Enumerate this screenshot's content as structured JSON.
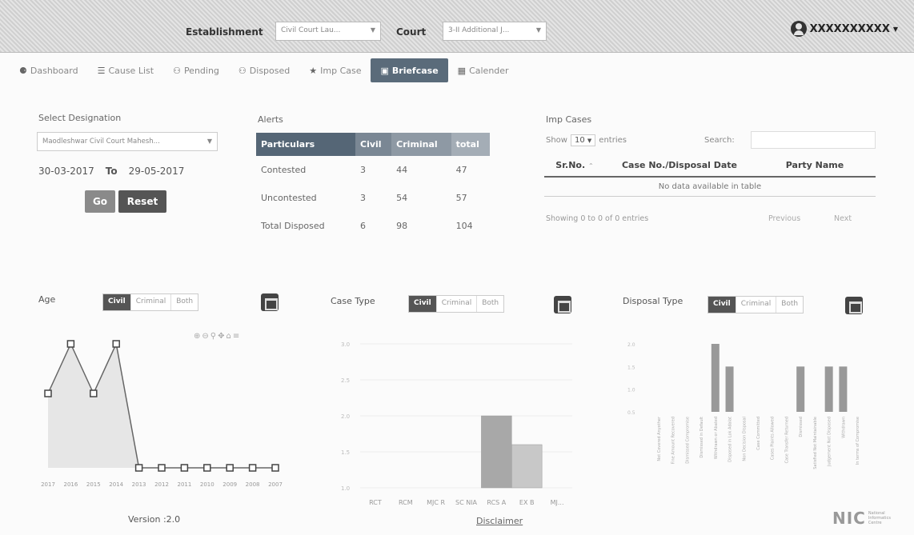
{
  "header": {
    "establishment_label": "Establishment",
    "establishment_value": "Civil Court Lau...",
    "court_label": "Court",
    "court_value": "3-II Additional J...",
    "user_name": "XXXXXXXXXX"
  },
  "tabs": [
    {
      "label": "Dashboard",
      "icon": "dashboard-icon"
    },
    {
      "label": "Cause List",
      "icon": "list-icon"
    },
    {
      "label": "Pending",
      "icon": "users-icon"
    },
    {
      "label": "Disposed",
      "icon": "users-icon"
    },
    {
      "label": "Imp Case",
      "icon": "star-icon"
    },
    {
      "label": "Briefcase",
      "icon": "briefcase-icon",
      "active": true
    },
    {
      "label": "Calender",
      "icon": "calendar-icon"
    }
  ],
  "designation": {
    "title": "Select Designation",
    "select_value": "Maodleshwar Civil Court Mahesh...",
    "from_date": "30-03-2017",
    "to_label": "To",
    "to_date": "29-05-2017",
    "go_label": "Go",
    "reset_label": "Reset"
  },
  "alerts": {
    "title": "Alerts",
    "headers": [
      "Particulars",
      "Civil",
      "Criminal",
      "total"
    ],
    "rows": [
      [
        "Contested",
        "3",
        "44",
        "47"
      ],
      [
        "Uncontested",
        "3",
        "54",
        "57"
      ],
      [
        "Total Disposed",
        "6",
        "98",
        "104"
      ]
    ]
  },
  "imp_cases": {
    "title": "Imp Cases",
    "show_label": "Show",
    "show_value": "10",
    "entries_label": "entries",
    "search_label": "Search:",
    "headers": [
      "Sr.No.",
      "Case No./Disposal Date",
      "Party Name"
    ],
    "empty_text": "No data available in table",
    "showing_text": "Showing 0 to 0 of 0 entries",
    "prev_label": "Previous",
    "next_label": "Next"
  },
  "toggle_labels": [
    "Civil",
    "Criminal",
    "Both"
  ],
  "colors": {
    "accent": "#5a6b7a",
    "go_button": "#8a8a8a",
    "reset_button": "#555555"
  },
  "chart_data": [
    {
      "type": "line",
      "title": "Age",
      "categories": [
        "2017",
        "2016",
        "2015",
        "2014",
        "2013",
        "2012",
        "2011",
        "2010",
        "2009",
        "2008",
        "2007"
      ],
      "values": [
        1.5,
        2.5,
        1.5,
        2.5,
        0,
        0,
        0,
        0,
        0,
        0,
        0
      ]
    },
    {
      "type": "bar",
      "title": "Case Type",
      "categories": [
        "RCT",
        "RCM",
        "MJC R",
        "SC NIA",
        "RCS A",
        "EX B",
        "MJ..."
      ],
      "values": [
        0,
        0,
        0,
        0,
        2,
        1.6,
        1
      ],
      "yticks": [
        "3.0",
        "2.5",
        "2.0",
        "1.5",
        "1.0"
      ],
      "ylim": [
        1.0,
        3.0
      ]
    },
    {
      "type": "bar",
      "title": "Disposal Type",
      "categories": [
        "Not Covered Anyother",
        "Fine Amount Recovered",
        "Dismissed Compromise",
        "Dismissed in Default",
        "Withdrawn or Abated",
        "Disposed in Lok Adalat",
        "Non Decision Disposal",
        "Case Committed",
        "Cases Plaints Allowed",
        "Case Transfer Returned",
        "Dismissed",
        "Satisfied Not Maintainable",
        "Judgement Not Disposed",
        "Withdrawn",
        "In terms of Compromise"
      ],
      "values": [
        0,
        0,
        0,
        0,
        2,
        1.5,
        0,
        0,
        0,
        0,
        1.5,
        0,
        1.5,
        1.5,
        0
      ],
      "yticks": [
        "2.0",
        "1.5",
        "1.0",
        "0.5"
      ],
      "ylim": [
        0.5,
        2.0
      ]
    }
  ],
  "footer": {
    "version": "Version :2.0",
    "disclaimer": "Disclaimer",
    "nic_logo": "NIC",
    "nic_line1": "National",
    "nic_line2": "Informatics",
    "nic_line3": "Centre"
  }
}
